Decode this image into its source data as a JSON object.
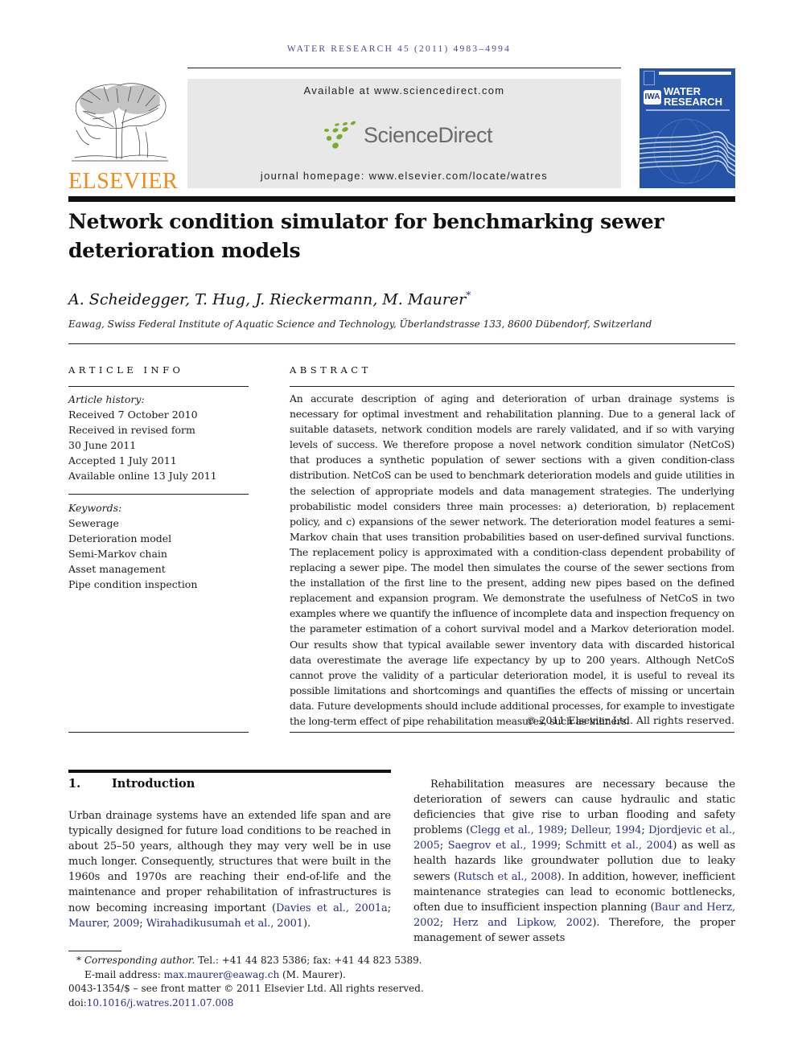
{
  "running_head": "WATER RESEARCH 45 (2011) 4983–4994",
  "header": {
    "publisher": "ELSEVIER",
    "available_at": "Available at www.sciencedirect.com",
    "sciencedirect_logo": "ScienceDirect",
    "journal_homepage": "journal homepage: www.elsevier.com/locate/watres",
    "cover": {
      "line1": "WATER",
      "line2": "RESEARCH",
      "iwa": "IWA"
    },
    "colors": {
      "elsevier_orange": "#f08a1c",
      "sciencedirect_green": "#7aac2a",
      "cover_blue": "#2553a8",
      "link_blue": "#2b2b8a"
    }
  },
  "article": {
    "title": "Network condition simulator for benchmarking sewer deterioration models",
    "authors": "A. Scheidegger, T. Hug, J. Rieckermann, M. Maurer",
    "corresponding_mark": "*",
    "affiliation": "Eawag, Swiss Federal Institute of Aquatic Science and Technology, Überlandstrasse 133, 8600 Dübendorf, Switzerland"
  },
  "article_info": {
    "heading": "ARTICLE INFO",
    "history_label": "Article history:",
    "history": [
      "Received 7 October 2010",
      "Received in revised form",
      "30 June 2011",
      "Accepted 1 July 2011",
      "Available online 13 July 2011"
    ],
    "keywords_label": "Keywords:",
    "keywords": [
      "Sewerage",
      "Deterioration model",
      "Semi-Markov chain",
      "Asset management",
      "Pipe condition inspection"
    ]
  },
  "abstract": {
    "heading": "ABSTRACT",
    "text": "An accurate description of aging and deterioration of urban drainage systems is necessary for optimal investment and rehabilitation planning. Due to a general lack of suitable datasets, network condition models are rarely validated, and if so with varying levels of success. We therefore propose a novel network condition simulator (NetCoS) that produces a synthetic population of sewer sections with a given condition-class distribution. NetCoS can be used to benchmark deterioration models and guide utilities in the selection of appropriate models and data management strategies. The underlying probabilistic model considers three main processes: a) deterioration, b) replacement policy, and c) expansions of the sewer network. The deterioration model features a semi-Markov chain that uses transition probabilities based on user-defined survival functions. The replacement policy is approximated with a condition-class dependent probability of replacing a sewer pipe. The model then simulates the course of the sewer sections from the installation of the first line to the present, adding new pipes based on the defined replacement and expansion program. We demonstrate the usefulness of NetCoS in two examples where we quantify the influence of incomplete data and inspection frequency on the parameter estimation of a cohort survival model and a Markov deterioration model. Our results show that typical available sewer inventory data with discarded historical data overestimate the average life expectancy by up to 200 years. Although NetCoS cannot prove the validity of a particular deterioration model, it is useful to reveal its possible limitations and shortcomings and quantifies the effects of missing or uncertain data. Future developments should include additional processes, for example to investigate the long-term effect of pipe rehabilitation measures, such as inliners.",
    "copyright": "© 2011 Elsevier Ltd. All rights reserved."
  },
  "introduction": {
    "number": "1.",
    "heading": "Introduction",
    "left_para": {
      "text": "Urban drainage systems have an extended life span and are typically designed for future load conditions to be reached in about 25–50 years, although they may very well be in use much longer. Consequently, structures that were built in the 1960s and 1970s are reaching their end-of-life and the maintenance and proper rehabilitation of infrastructures is now becoming increasing important (",
      "refs": [
        "Davies et al., 2001a",
        "Maurer, 2009",
        "Wirahadikusumah et al., 2001"
      ],
      "tail": ")."
    },
    "right_para": {
      "part1": "Rehabilitation measures are necessary because the deterioration of sewers can cause hydraulic and static deficiencies that give rise to urban flooding and safety problems (",
      "refs1": [
        "Clegg et al., 1989",
        "Delleur, 1994",
        "Djordjevic et al., 2005",
        "Saegrov et al., 1999",
        "Schmitt et al., 2004"
      ],
      "part2": ") as well as health hazards like groundwater pollution due to leaky sewers (",
      "refs2": [
        "Rutsch et al., 2008"
      ],
      "part3": "). In addition, however, inefficient maintenance strategies can lead to economic bottlenecks, often due to insufficient inspection planning (",
      "refs3": [
        "Baur and Herz, 2002",
        "Herz and Lipkow, 2002"
      ],
      "part4": "). Therefore, the proper management of sewer assets"
    }
  },
  "footnotes": {
    "mark": "*",
    "corresponding_label": "Corresponding author.",
    "contact": " Tel.: +41 44 823 5386; fax: +41 44 823 5389.",
    "email_label": "E-mail address: ",
    "email": "max.maurer@eawag.ch",
    "email_tail": " (M. Maurer).",
    "front_matter": "0043-1354/$ – see front matter © 2011 Elsevier Ltd. All rights reserved.",
    "doi_label": "doi:",
    "doi": "10.1016/j.watres.2011.07.008"
  }
}
